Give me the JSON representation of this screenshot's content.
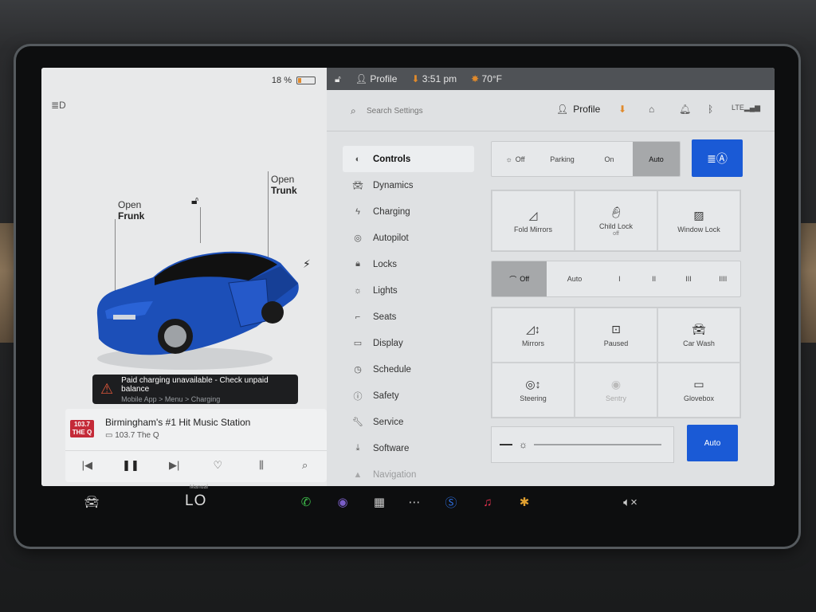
{
  "status_bar": {
    "battery_percent": "18 %",
    "battery_level": 0.18,
    "profile": "Profile",
    "time": "3:51 pm",
    "temperature": "70°F"
  },
  "car_panel": {
    "frunk_callout": {
      "line1": "Open",
      "line2": "Frunk"
    },
    "trunk_callout": {
      "line1": "Open",
      "line2": "Trunk"
    },
    "alert": {
      "title": "Paid charging unavailable - Check unpaid balance",
      "subtitle": "Mobile App > Menu > Charging"
    }
  },
  "media": {
    "logo_text": "103.7 THE Q",
    "title": "Birmingham's #1 Hit Music Station",
    "station": "103.7 The Q"
  },
  "settings": {
    "search_placeholder": "Search Settings",
    "profile": "Profile",
    "nav": [
      {
        "label": "Controls",
        "icon": "toggle-icon"
      },
      {
        "label": "Dynamics",
        "icon": "car-icon"
      },
      {
        "label": "Charging",
        "icon": "bolt-icon"
      },
      {
        "label": "Autopilot",
        "icon": "steering-wheel-icon"
      },
      {
        "label": "Locks",
        "icon": "lock-icon"
      },
      {
        "label": "Lights",
        "icon": "bulb-icon"
      },
      {
        "label": "Seats",
        "icon": "seat-icon"
      },
      {
        "label": "Display",
        "icon": "display-icon"
      },
      {
        "label": "Schedule",
        "icon": "clock-icon"
      },
      {
        "label": "Safety",
        "icon": "info-icon"
      },
      {
        "label": "Service",
        "icon": "wrench-icon"
      },
      {
        "label": "Software",
        "icon": "download-icon"
      },
      {
        "label": "Navigation",
        "icon": "navigation-icon"
      }
    ],
    "headlights": [
      "Off",
      "Parking",
      "On",
      "Auto"
    ],
    "headlights_selected": "Auto",
    "tiles_row1": [
      {
        "label": "Fold Mirrors",
        "sub": ""
      },
      {
        "label": "Child Lock",
        "sub": "off"
      },
      {
        "label": "Window Lock",
        "sub": ""
      }
    ],
    "wipers": [
      "Off",
      "Auto",
      "I",
      "II",
      "III",
      "IIII"
    ],
    "wipers_selected": "Off",
    "tiles_row2": [
      {
        "label": "Mirrors"
      },
      {
        "label": "Paused"
      },
      {
        "label": "Car Wash"
      },
      {
        "label": "Steering"
      },
      {
        "label": "Sentry"
      },
      {
        "label": "Glovebox"
      }
    ],
    "brightness_auto": "Auto"
  },
  "taskbar": {
    "temp_mode": "Manual",
    "temp": "LO"
  },
  "colors": {
    "accent": "#1a5ad6",
    "orange": "#e08a2c",
    "alert_red": "#e0573a"
  }
}
